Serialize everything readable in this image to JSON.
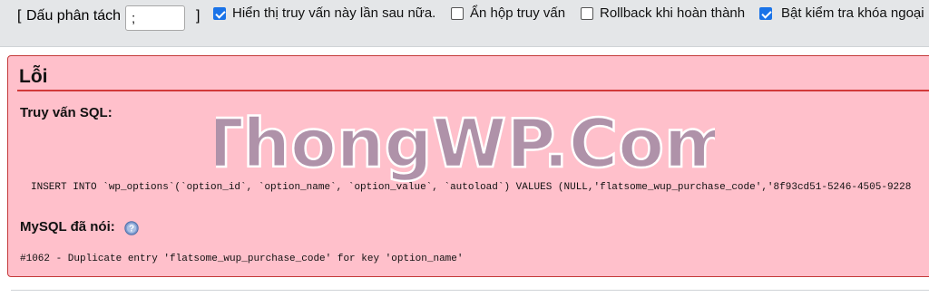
{
  "options": {
    "bracket_open": "[",
    "delimiter_label": "Dấu phân tách",
    "delimiter_value": ";",
    "bracket_close": "]",
    "checkboxes": [
      {
        "label": "Hiển thị truy vấn này lần sau nữa.",
        "checked": true
      },
      {
        "label": "Ẩn hộp truy vấn",
        "checked": false
      },
      {
        "label": "Rollback khi hoàn thành",
        "checked": false
      },
      {
        "label": "Bật kiểm tra khóa ngoại",
        "checked": true
      }
    ]
  },
  "error": {
    "title": "Lỗi",
    "sql_heading": "Truy vấn SQL:",
    "sql_query": "INSERT INTO `wp_options`(`option_id`, `option_name`, `option_value`, `autoload`) VALUES (NULL,'flatsome_wup_purchase_code','8f93cd51-5246-4505-9228",
    "mysql_heading": "MySQL đã nói:",
    "mysql_message": "#1062 - Duplicate entry 'flatsome_wup_purchase_code' for key 'option_name'"
  },
  "watermark": {
    "text": "ThongWP.Com"
  },
  "colors": {
    "error_background": "#ffc0cb",
    "error_border": "#c43a3a",
    "checkbox_accent": "#1a73e8",
    "toolbar_background": "#e4e6e8"
  },
  "icons": {
    "help": "help-icon"
  }
}
